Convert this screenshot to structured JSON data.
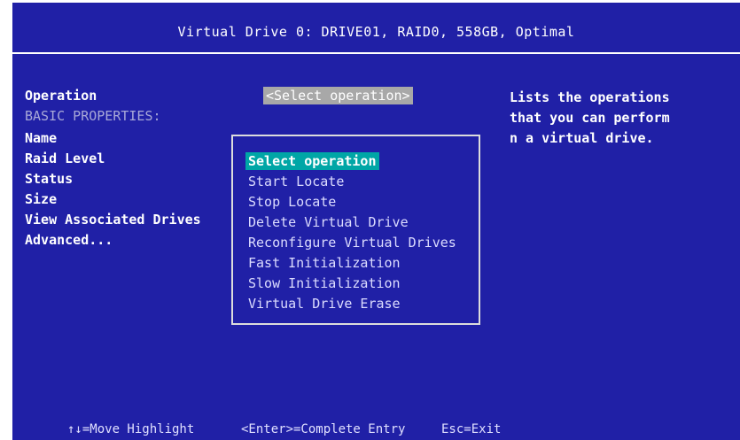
{
  "screen": {
    "title": "Virtual Drive 0: DRIVE01, RAID0, 558GB, Optimal",
    "colors": {
      "background": "#2020a6",
      "highlight": "#00a6a6",
      "field": "#a8a8a8"
    }
  },
  "form": {
    "operation_label": "Operation",
    "operation_value": "<Select operation>",
    "basic_properties_label": "BASIC PROPERTIES:",
    "name_label": "Name",
    "raid_level_label": "Raid Level",
    "status_label": "Status",
    "size_label": "Size",
    "view_drives_label": "View Associated Drives",
    "advanced_label": "Advanced..."
  },
  "help": {
    "text": "Lists the operations\nthat you can perform\nn a virtual drive."
  },
  "popup": {
    "options": [
      {
        "label": "Select operation",
        "state": "selected"
      },
      {
        "label": "Start Locate",
        "state": "enabled"
      },
      {
        "label": "Stop Locate",
        "state": "enabled"
      },
      {
        "label": "Delete Virtual Drive",
        "state": "enabled"
      },
      {
        "label": "Reconfigure Virtual Drives",
        "state": "enabled"
      },
      {
        "label": "Fast Initialization",
        "state": "enabled"
      },
      {
        "label": "Slow Initialization",
        "state": "enabled"
      },
      {
        "label": "Virtual Drive Erase",
        "state": "enabled"
      }
    ]
  },
  "footer": {
    "move": "↑↓=Move Highlight",
    "enter": "<Enter>=Complete Entry",
    "esc": "Esc=Exit"
  }
}
